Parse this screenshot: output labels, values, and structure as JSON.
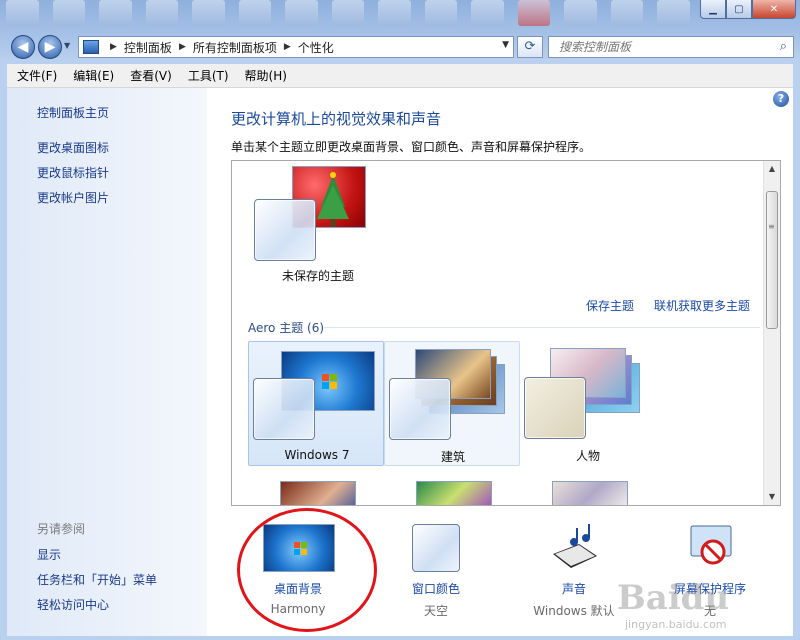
{
  "address": {
    "crumbs": [
      "控制面板",
      "所有控制面板项",
      "个性化"
    ]
  },
  "search": {
    "placeholder": "搜索控制面板"
  },
  "menu": [
    "文件(F)",
    "编辑(E)",
    "查看(V)",
    "工具(T)",
    "帮助(H)"
  ],
  "sidebar": {
    "home": "控制面板主页",
    "links": [
      "更改桌面图标",
      "更改鼠标指针",
      "更改帐户图片"
    ],
    "see_also_title": "另请参阅",
    "see_also": [
      "显示",
      "任务栏和「开始」菜单",
      "轻松访问中心"
    ]
  },
  "main": {
    "heading": "更改计算机上的视觉效果和声音",
    "subtext": "单击某个主题立即更改桌面背景、窗口颜色、声音和屏幕保护程序。",
    "unsaved_theme": "未保存的主题",
    "save_theme": "保存主题",
    "get_more_themes": "联机获取更多主题",
    "aero_group": "Aero 主题 (6)",
    "themes": [
      "Windows 7",
      "建筑",
      "人物"
    ]
  },
  "bottom": [
    {
      "label": "桌面背景",
      "value": "Harmony"
    },
    {
      "label": "窗口颜色",
      "value": "天空"
    },
    {
      "label": "声音",
      "value": "Windows 默认"
    },
    {
      "label": "屏幕保护程序",
      "value": "无"
    }
  ],
  "watermark": {
    "brand": "Baidu",
    "site": "jingyan.baidu.com"
  },
  "colors": {
    "link": "#1a4aa8",
    "heading": "#1a4a9c",
    "highlight_circle": "#e2141a"
  }
}
